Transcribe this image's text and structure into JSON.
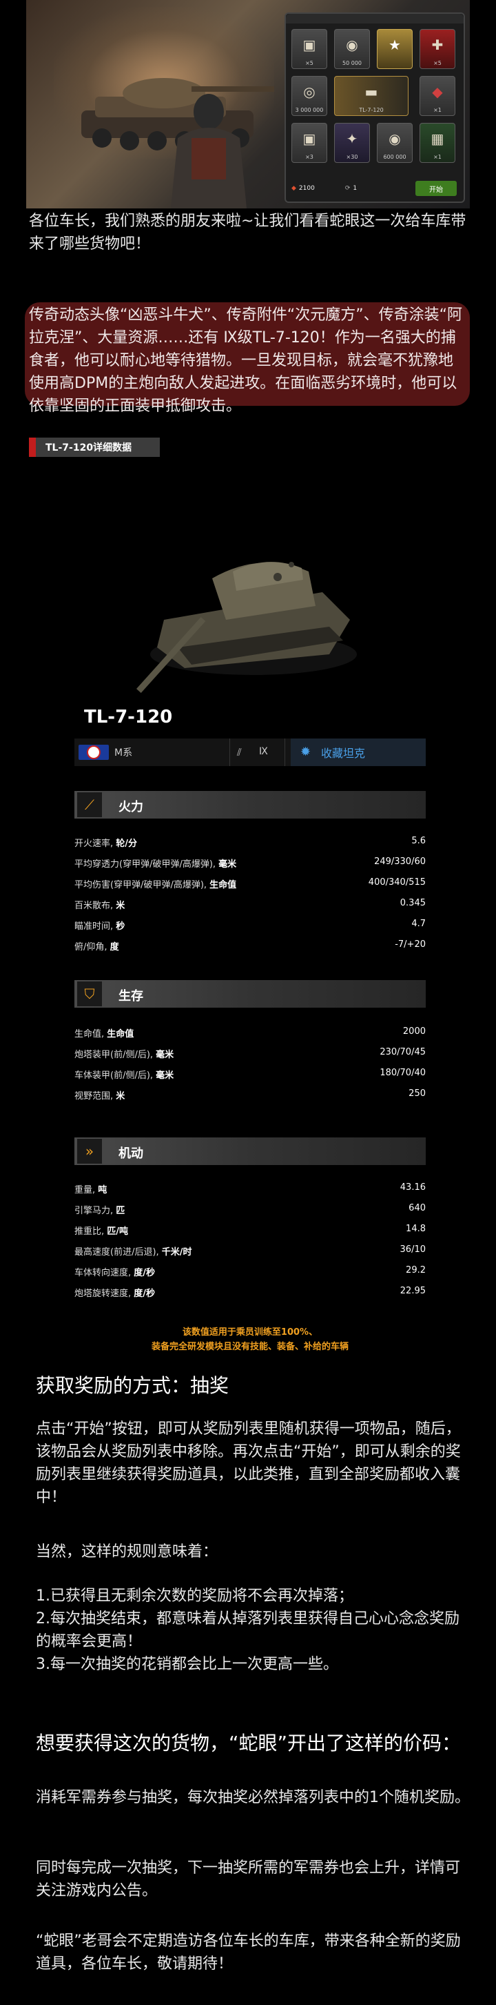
{
  "banner": {
    "tiles": [
      {
        "label": "×5",
        "icon": "tank-box-icon"
      },
      {
        "label": "50 000",
        "icon": "silver-icon"
      },
      {
        "label": "",
        "icon": "star-icon"
      },
      {
        "label": "×5",
        "icon": "red-crate-icon"
      },
      {
        "label": "3 000 000",
        "icon": "silver-stack-icon"
      },
      {
        "label": "TL-7-120",
        "icon": "tank-icon"
      },
      {
        "label": "×1",
        "icon": "red-crate-icon"
      },
      {
        "label": "×3",
        "icon": "tank-box-icon"
      },
      {
        "label": "×30",
        "icon": "consumable-icon"
      },
      {
        "label": "600 000",
        "icon": "silver-icon"
      },
      {
        "label": "×1",
        "icon": "crate-icon"
      }
    ],
    "cost": "2100",
    "attempt": "1",
    "start_label": "开始"
  },
  "intro": "各位车长，我们熟悉的朋友来啦~让我们看看蛇眼这一次给车库带来了哪些货物吧！",
  "highlight": "传奇动态头像“凶恶斗牛犬”、传奇附件“次元魔方”、传奇涂装“阿拉克涅”、大量资源……还有 Ⅸ级TL-7-120！作为一名强大的捕食者，他可以耐心地等待猎物。一旦发现目标，就会毫不犹豫地使用高DPM的主炮向敌人发起进攻。在面临恶劣环境时，他可以依靠坚固的正面装甲抵御攻击。",
  "detail_tag": "TL-7-120详细数据",
  "tank": {
    "name": "TL-7-120",
    "nation": "M系",
    "tier": "Ⅸ",
    "collect_label": "收藏坦克"
  },
  "categories": {
    "firepower": "火力",
    "survival": "生存",
    "mobility": "机动"
  },
  "firepower": [
    {
      "name": "开火速率, ",
      "unit": "轮/分",
      "value": "5.6"
    },
    {
      "name": "平均穿透力(穿甲弹/破甲弹/高爆弹), ",
      "unit": "毫米",
      "value": "249/330/60"
    },
    {
      "name": "平均伤害(穿甲弹/破甲弹/高爆弹), ",
      "unit": "生命值",
      "value": "400/340/515"
    },
    {
      "name": "百米散布, ",
      "unit": "米",
      "value": "0.345"
    },
    {
      "name": "瞄准时间, ",
      "unit": "秒",
      "value": "4.7"
    },
    {
      "name": "俯/仰角, ",
      "unit": "度",
      "value": "-7/+20"
    }
  ],
  "survival": [
    {
      "name": "生命值, ",
      "unit": "生命值",
      "value": "2000"
    },
    {
      "name": "炮塔装甲(前/侧/后), ",
      "unit": "毫米",
      "value": "230/70/45"
    },
    {
      "name": "车体装甲(前/侧/后), ",
      "unit": "毫米",
      "value": "180/70/40"
    },
    {
      "name": "视野范围, ",
      "unit": "米",
      "value": "250"
    }
  ],
  "mobility": [
    {
      "name": "重量, ",
      "unit": "吨",
      "value": "43.16"
    },
    {
      "name": "引擎马力, ",
      "unit": "匹",
      "value": "640"
    },
    {
      "name": "推重比, ",
      "unit": "匹/吨",
      "value": "14.8"
    },
    {
      "name": "最高速度(前进/后退), ",
      "unit": "千米/时",
      "value": "36/10"
    },
    {
      "name": "车体转向速度, ",
      "unit": "度/秒",
      "value": "29.2"
    },
    {
      "name": "炮塔旋转速度, ",
      "unit": "度/秒",
      "value": "22.95"
    }
  ],
  "note_line1": "该数值适用于乘员训练至100%、",
  "note_line2": "装备完全研发模块且没有技能、装备、补给的车辆",
  "how_title": "获取奖励的方式：抽奖",
  "how_p1": "点击“开始”按钮，即可从奖励列表里随机获得一项物品，随后，该物品会从奖励列表中移除。再次点击“开始”，即可从剩余的奖励列表里继续获得奖励道具，以此类推，直到全部奖励都收入囊中！",
  "how_p2": "当然，这样的规则意味着：",
  "rule1": "1.已获得且无剩余次数的奖励将不会再次掉落；",
  "rule2": "2.每次抽奖结束，都意味着从掉落列表里获得自己心心念念奖励的概率会更高！",
  "rule3": "3.每一次抽奖的花销都会比上一次更高一些。",
  "price_title": "想要获得这次的货物，“蛇眼”开出了这样的价码：",
  "price_p1": "消耗军需券参与抽奖，每次抽奖必然掉落列表中的1个随机奖励。",
  "price_p2": "同时每完成一次抽奖，下一抽奖所需的军需券也会上升，详情可关注游戏内公告。",
  "closing": "“蛇眼”老哥会不定期造访各位车长的车库，带来各种全新的奖励道具，各位车长，敬请期待！"
}
